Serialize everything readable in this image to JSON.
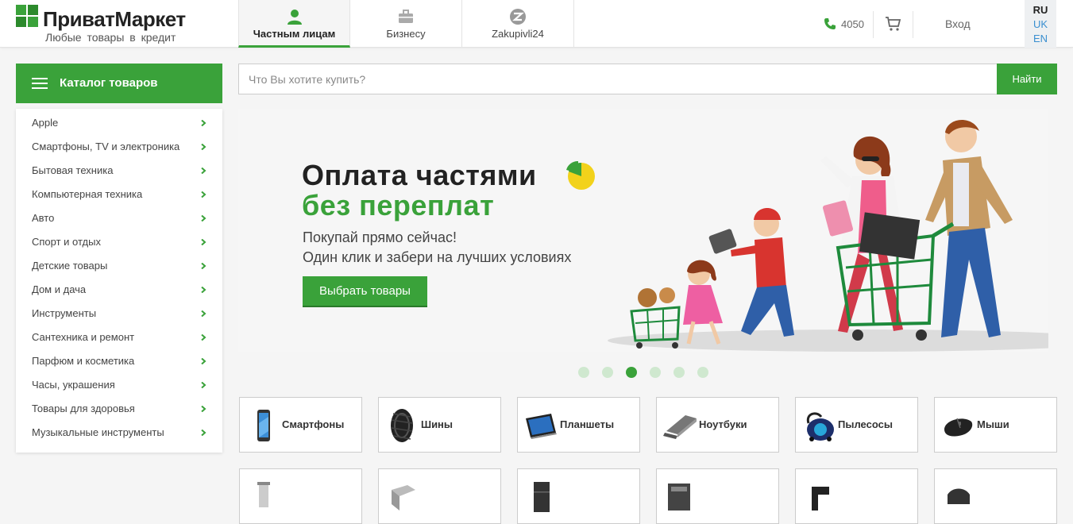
{
  "brand": {
    "name": "ПриватМаркет",
    "tagline": "Любые товары в кредит",
    "accent": "#3aa23a"
  },
  "tabs": [
    {
      "label": "Частным лицам",
      "icon": "person-icon",
      "active": true
    },
    {
      "label": "Бизнесу",
      "icon": "briefcase-icon",
      "active": false
    },
    {
      "label": "Zakupivli24",
      "icon": "zakupivli-logo-icon",
      "active": false
    }
  ],
  "header": {
    "phone": "4050",
    "login": "Вход",
    "languages": [
      "RU",
      "UK",
      "EN"
    ],
    "active_language": "RU"
  },
  "catalog": {
    "title": "Каталог товаров",
    "items": [
      "Apple",
      "Смартфоны, TV и электроника",
      "Бытовая техника",
      "Компьютерная техника",
      "Авто",
      "Спорт и отдых",
      "Детские товары",
      "Дом и дача",
      "Инструменты",
      "Сантехника и ремонт",
      "Парфюм и косметика",
      "Часы, украшения",
      "Товары для здоровья",
      "Музыкальные инструменты"
    ]
  },
  "search": {
    "placeholder": "Что Вы хотите купить?",
    "value": "",
    "button": "Найти"
  },
  "banner": {
    "title_line1": "Оплата частями",
    "title_line2": "без переплат",
    "subtitle_line1": "Покупай прямо сейчас!",
    "subtitle_line2": "Один клик и забери на лучших условиях",
    "button": "Выбрать товары",
    "illustration": "family-shopping-cart-illustration",
    "slides": 6,
    "active_slide": 3
  },
  "categories": [
    {
      "label": "Смартфоны",
      "icon": "smartphone-icon"
    },
    {
      "label": "Шины",
      "icon": "tire-icon"
    },
    {
      "label": "Планшеты",
      "icon": "tablet-icon"
    },
    {
      "label": "Ноутбуки",
      "icon": "laptop-icon"
    },
    {
      "label": "Пылесосы",
      "icon": "vacuum-cleaner-icon"
    },
    {
      "label": "Мыши",
      "icon": "computer-mouse-icon"
    }
  ]
}
